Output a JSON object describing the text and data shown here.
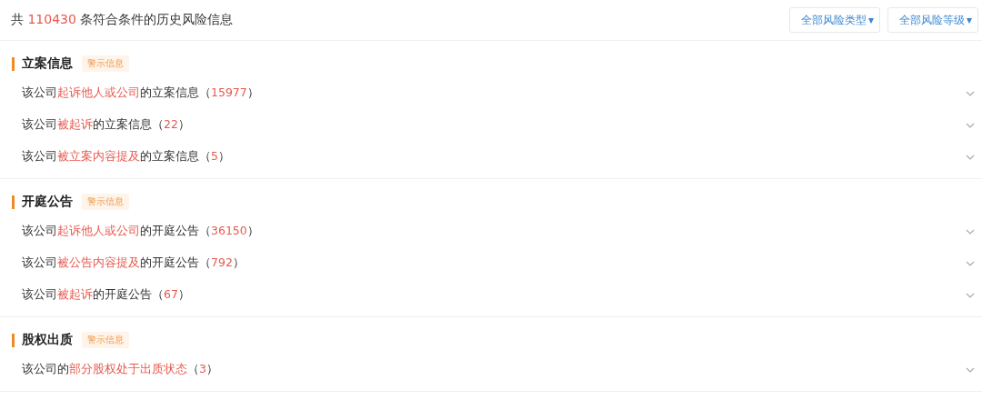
{
  "summary": {
    "prefix": "共",
    "count": "110430",
    "suffix": "条符合条件的历史风险信息"
  },
  "filters": [
    {
      "label": "全部风险类型",
      "icon": "▾"
    },
    {
      "label": "全部风险等级",
      "icon": "▾"
    }
  ],
  "sections": [
    {
      "title": "立案信息",
      "tag": "警示信息",
      "rows": [
        {
          "expanded": false,
          "segments": [
            {
              "kind": "plain",
              "text": "该公司"
            },
            {
              "kind": "highlight",
              "text": "起诉他人或公司"
            },
            {
              "kind": "plain",
              "text": "的立案信息（"
            },
            {
              "kind": "highlight",
              "text": "15977"
            },
            {
              "kind": "plain",
              "text": "）"
            }
          ]
        },
        {
          "expanded": false,
          "segments": [
            {
              "kind": "plain",
              "text": "该公司"
            },
            {
              "kind": "highlight",
              "text": "被起诉"
            },
            {
              "kind": "plain",
              "text": "的立案信息（"
            },
            {
              "kind": "highlight",
              "text": "22"
            },
            {
              "kind": "plain",
              "text": "）"
            }
          ]
        },
        {
          "expanded": false,
          "segments": [
            {
              "kind": "plain",
              "text": "该公司"
            },
            {
              "kind": "highlight",
              "text": "被立案内容提及"
            },
            {
              "kind": "plain",
              "text": "的立案信息（"
            },
            {
              "kind": "highlight",
              "text": "5"
            },
            {
              "kind": "plain",
              "text": "）"
            }
          ]
        }
      ]
    },
    {
      "title": "开庭公告",
      "tag": "警示信息",
      "rows": [
        {
          "expanded": false,
          "segments": [
            {
              "kind": "plain",
              "text": "该公司"
            },
            {
              "kind": "highlight",
              "text": "起诉他人或公司"
            },
            {
              "kind": "plain",
              "text": "的开庭公告（"
            },
            {
              "kind": "highlight",
              "text": "36150"
            },
            {
              "kind": "plain",
              "text": "）"
            }
          ]
        },
        {
          "expanded": false,
          "segments": [
            {
              "kind": "plain",
              "text": "该公司"
            },
            {
              "kind": "highlight",
              "text": "被公告内容提及"
            },
            {
              "kind": "plain",
              "text": "的开庭公告（"
            },
            {
              "kind": "highlight",
              "text": "792"
            },
            {
              "kind": "plain",
              "text": "）"
            }
          ]
        },
        {
          "expanded": false,
          "segments": [
            {
              "kind": "plain",
              "text": "该公司"
            },
            {
              "kind": "highlight",
              "text": "被起诉"
            },
            {
              "kind": "plain",
              "text": "的开庭公告（"
            },
            {
              "kind": "highlight",
              "text": "67"
            },
            {
              "kind": "plain",
              "text": "）"
            }
          ]
        }
      ]
    },
    {
      "title": "股权出质",
      "tag": "警示信息",
      "rows": [
        {
          "expanded": false,
          "segments": [
            {
              "kind": "plain",
              "text": "该公司的"
            },
            {
              "kind": "highlight",
              "text": "部分股权处于出质状态"
            },
            {
              "kind": "plain",
              "text": "（"
            },
            {
              "kind": "highlight",
              "text": "3"
            },
            {
              "kind": "plain",
              "text": "）"
            }
          ]
        }
      ]
    }
  ]
}
